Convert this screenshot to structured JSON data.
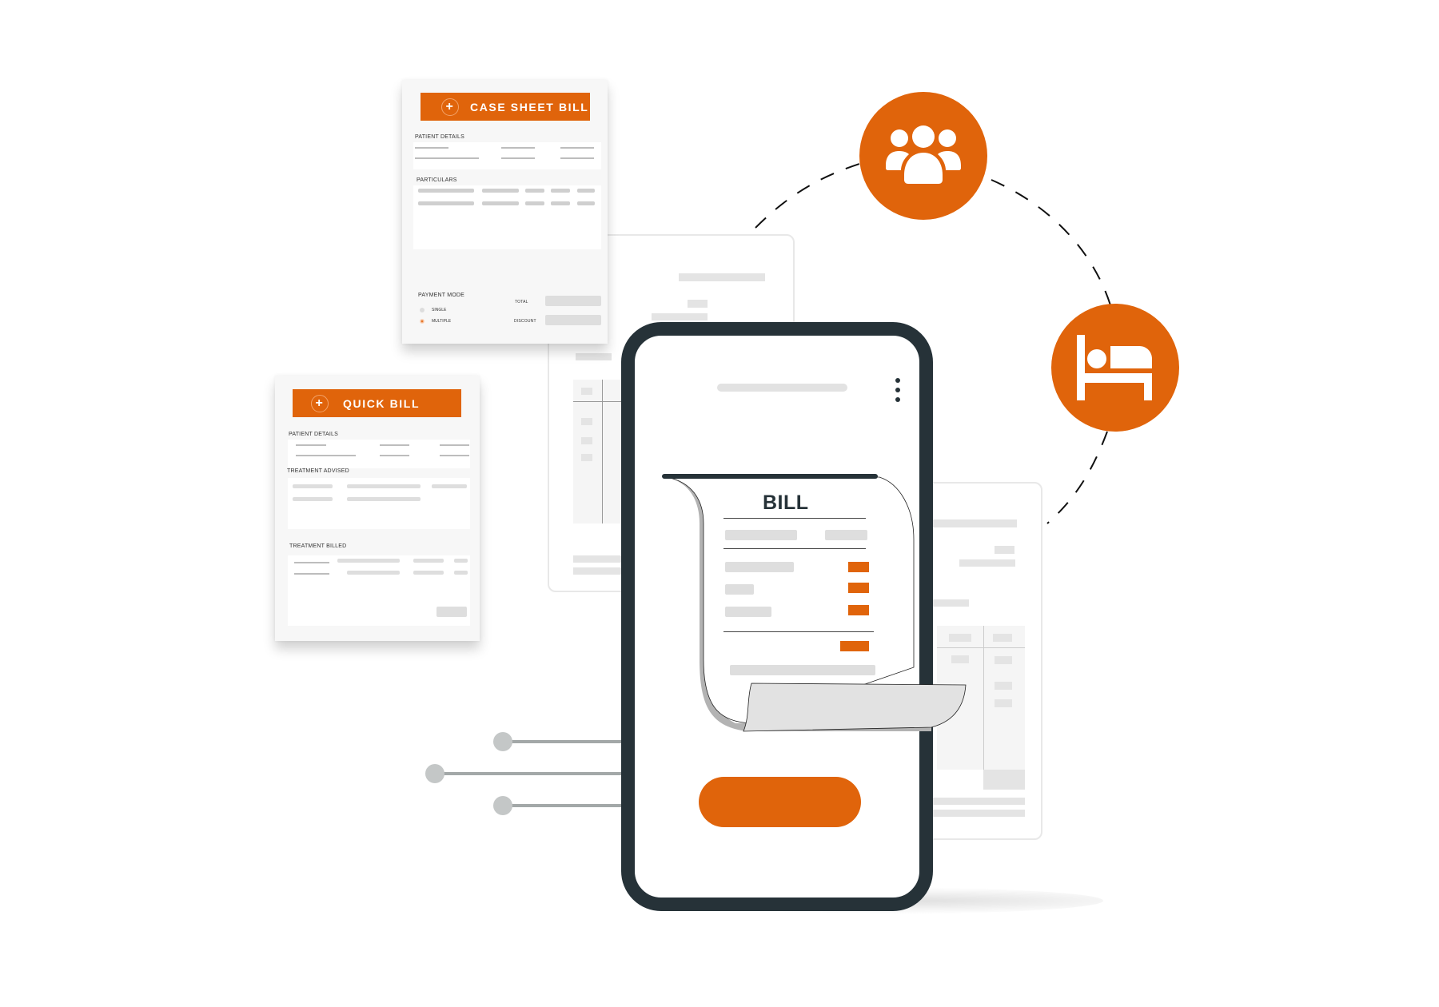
{
  "illustration": {
    "theme": "medical billing",
    "accent_color": "#e0640b",
    "frame_color": "#263238"
  },
  "case_sheet_bill": {
    "title": "CASE SHEET BILL",
    "icon": "plus-circle-icon",
    "sections": {
      "patient_details": "PATIENT DETAILS",
      "particulars": "PARTICULARS",
      "payment_mode": "PAYMENT MODE"
    },
    "payment_options": [
      {
        "label": "SINGLE",
        "selected": false
      },
      {
        "label": "MULTIPLE",
        "selected": true
      }
    ],
    "totals": {
      "total_label": "TOTAL",
      "discount_label": "DISCOUNT"
    }
  },
  "quick_bill": {
    "title": "QUICK BILL",
    "icon": "plus-circle-icon",
    "sections": {
      "patient_details": "PATIENT DETAILS",
      "treatment_advised": "TREATMENT ADVISED",
      "treatment_billed": "TREATMENT BILLED"
    }
  },
  "phone": {
    "menu_icon": "kebab-menu-icon",
    "receipt": {
      "title": "BILL",
      "line_items": 3
    },
    "cta_button": ""
  },
  "orbit_icons": [
    {
      "name": "patients",
      "icon": "users-group-icon"
    },
    {
      "name": "inpatient",
      "icon": "bed-icon"
    }
  ]
}
